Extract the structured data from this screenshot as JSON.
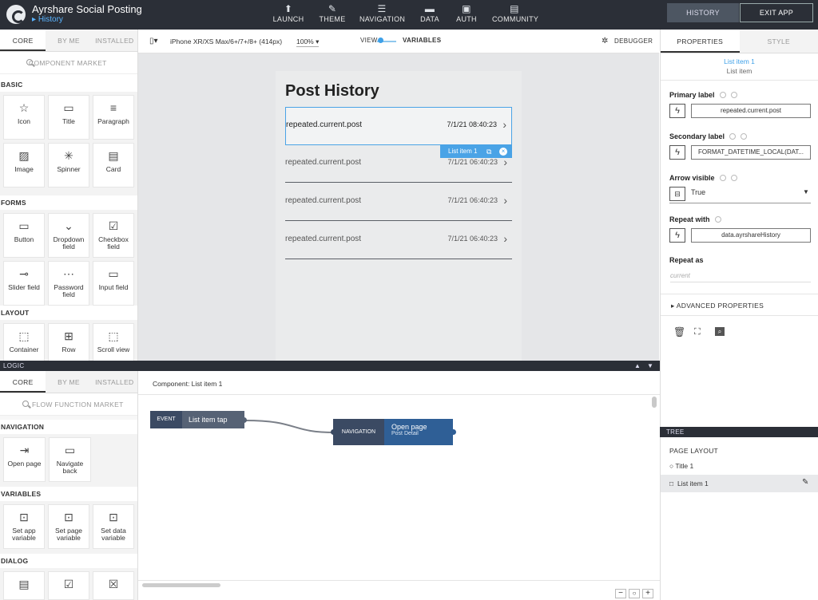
{
  "app": {
    "title": "Ayrshare Social Posting",
    "page": "History"
  },
  "nav": {
    "tabs": [
      {
        "label": "LAUNCH"
      },
      {
        "label": "THEME"
      },
      {
        "label": "NAVIGATION"
      },
      {
        "label": "DATA"
      },
      {
        "label": "AUTH"
      },
      {
        "label": "COMMUNITY"
      }
    ],
    "history_label": "HISTORY",
    "exit_label": "EXIT APP"
  },
  "components": {
    "tabs": [
      "CORE",
      "BY ME",
      "INSTALLED"
    ],
    "search_placeholder": "COMPONENT MARKET",
    "sections": [
      {
        "label": "BASIC",
        "items": [
          "Icon",
          "Title",
          "Paragraph",
          "Image",
          "Spinner",
          "Card"
        ]
      },
      {
        "label": "FORMS",
        "items": [
          "Button",
          "Dropdown field",
          "Checkbox field",
          "Slider field",
          "Password field",
          "Input field"
        ]
      },
      {
        "label": "LAYOUT",
        "items": [
          "Container",
          "Row",
          "Scroll view"
        ]
      }
    ]
  },
  "canvas": {
    "device": "iPhone XR/XS Max/6+/7+/8+ (414px)",
    "zoom": "100%",
    "view_label": "VIEW",
    "variables_label": "VARIABLES",
    "debugger_label": "DEBUGGER",
    "page_title": "Post History",
    "rows": [
      {
        "primary": "repeated.current.post",
        "secondary": "7/1/21 08:40:23"
      },
      {
        "primary": "repeated.current.post",
        "secondary": "7/1/21 06:40:23"
      },
      {
        "primary": "repeated.current.post",
        "secondary": "7/1/21 06:40:23"
      },
      {
        "primary": "repeated.current.post",
        "secondary": "7/1/21 06:40:23"
      }
    ],
    "selected_tag": "List item 1"
  },
  "properties": {
    "tabs": [
      "PROPERTIES",
      "STYLE"
    ],
    "selected_name": "List item 1",
    "selected_type": "List item",
    "primary_label": {
      "label": "Primary label",
      "value": "repeated.current.post"
    },
    "secondary_label": {
      "label": "Secondary label",
      "value": "FORMAT_DATETIME_LOCAL(DAT..."
    },
    "arrow_visible": {
      "label": "Arrow visible",
      "value": "True"
    },
    "repeat_with": {
      "label": "Repeat with",
      "value": "data.ayrshareHistory"
    },
    "repeat_as": {
      "label": "Repeat as",
      "placeholder": "current"
    },
    "advanced": "ADVANCED PROPERTIES"
  },
  "logic": {
    "bar_label": "LOGIC",
    "tabs": [
      "CORE",
      "BY ME",
      "INSTALLED"
    ],
    "search_placeholder": "FLOW FUNCTION MARKET",
    "sections": [
      {
        "label": "NAVIGATION",
        "items": [
          "Open page",
          "Navigate back"
        ]
      },
      {
        "label": "VARIABLES",
        "items": [
          "Set app variable",
          "Set page variable",
          "Set data variable"
        ]
      },
      {
        "label": "DIALOG",
        "items": [
          "",
          "",
          ""
        ]
      }
    ],
    "component_label": "Component: List item 1",
    "event_node": {
      "tag": "EVENT",
      "label": "List item tap"
    },
    "nav_node": {
      "tag": "NAVIGATION",
      "label": "Open page",
      "sub": "Post Detail"
    }
  },
  "tree": {
    "bar_label": "TREE",
    "root": "PAGE LAYOUT",
    "items": [
      "Title 1",
      "List item 1"
    ]
  },
  "colors": {
    "topbar": "#2b2f37",
    "accent": "#5ab4ff",
    "node_dark": "#3b4a63",
    "node_blue": "#2f5f96"
  }
}
